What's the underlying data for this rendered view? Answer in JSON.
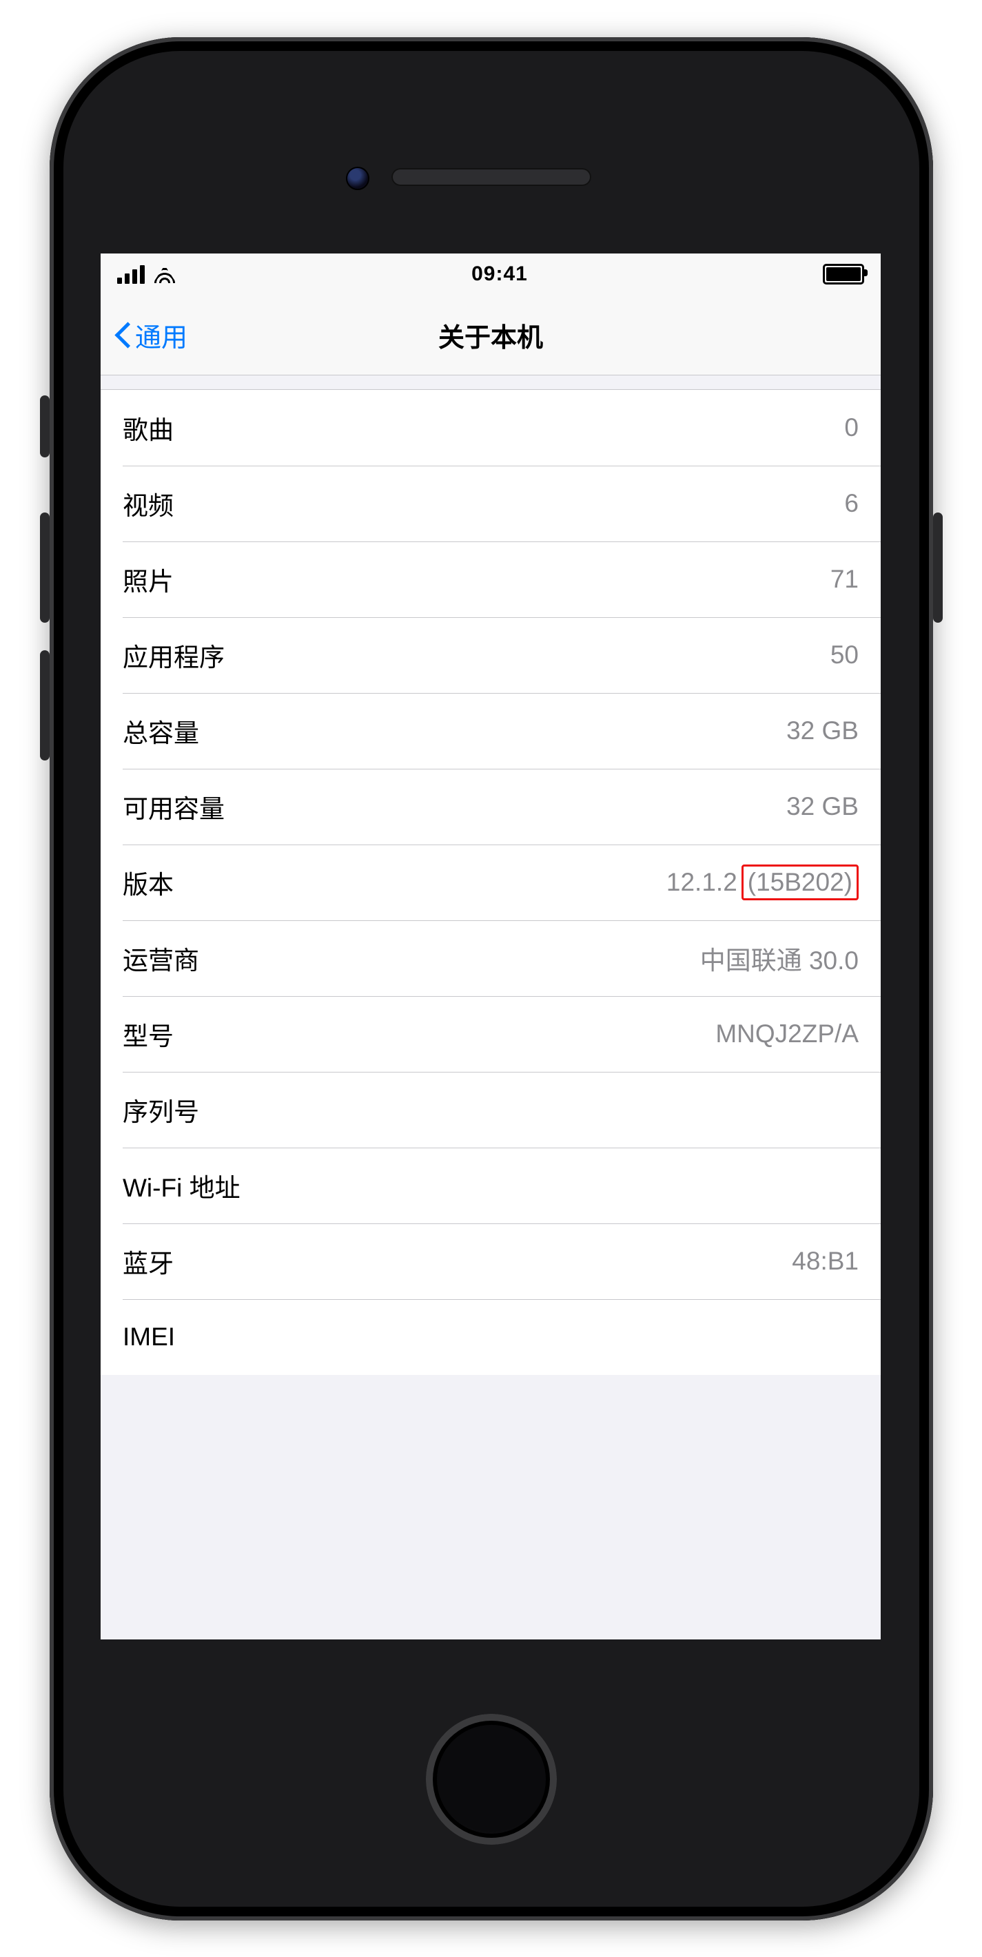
{
  "statusbar": {
    "time": "09:41"
  },
  "navbar": {
    "back_label": "通用",
    "title": "关于本机"
  },
  "rows": [
    {
      "label": "歌曲",
      "value": "0"
    },
    {
      "label": "视频",
      "value": "6"
    },
    {
      "label": "照片",
      "value": "71"
    },
    {
      "label": "应用程序",
      "value": "50"
    },
    {
      "label": "总容量",
      "value": "32 GB"
    },
    {
      "label": "可用容量",
      "value": "32 GB"
    },
    {
      "label": "版本",
      "value": "12.1.2",
      "value_extra": "(15B202)",
      "highlight_extra": true
    },
    {
      "label": "运营商",
      "value": "中国联通 30.0"
    },
    {
      "label": "型号",
      "value": "MNQJ2ZP/A"
    },
    {
      "label": "序列号",
      "value": ""
    },
    {
      "label": "Wi-Fi 地址",
      "value": ""
    },
    {
      "label": "蓝牙",
      "value": "48:B1"
    },
    {
      "label": "IMEI",
      "value": ""
    }
  ]
}
